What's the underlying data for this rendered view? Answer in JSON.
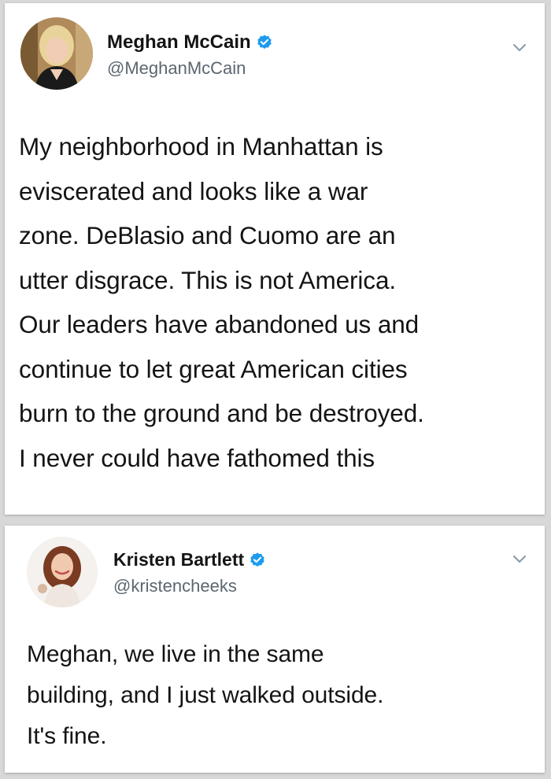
{
  "tweets": [
    {
      "display_name": "Meghan McCain",
      "handle": "@MeghanMcCain",
      "verified": true,
      "text": "My neighborhood in Manhattan is\neviscerated and looks like a war\nzone. DeBlasio and Cuomo are an\nutter disgrace. This is not America.\nOur leaders have abandoned us and\ncontinue to let great American cities\nburn to the ground and be destroyed.\nI never could have fathomed this",
      "avatar_icon": "profile-photo-woman-blonde"
    },
    {
      "display_name": "Kristen Bartlett",
      "handle": "@kristencheeks",
      "verified": true,
      "text": "Meghan, we live in the same\nbuilding, and I just walked outside.\nIt's fine.",
      "avatar_icon": "profile-photo-woman-brunette"
    }
  ],
  "colors": {
    "verified_blue": "#1d9bf0",
    "handle_gray": "#5b6670",
    "text": "#141414",
    "background": "#d8d8d8"
  },
  "icons": {
    "verified": "verified-badge-icon",
    "menu": "chevron-down-icon"
  }
}
